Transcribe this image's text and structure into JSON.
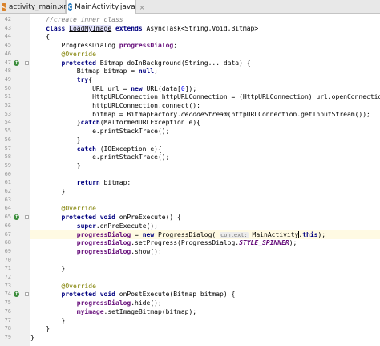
{
  "tabs": [
    {
      "label": "activity_main.xml",
      "icon": "xml-file-icon"
    },
    {
      "label": "MainActivity.java",
      "icon": "java-class-icon"
    }
  ],
  "lines": [
    {
      "n": "42",
      "t": [
        [
          "cmt",
          "    //create inner class"
        ]
      ]
    },
    {
      "n": "43",
      "t": [
        [
          "kw",
          "    class "
        ],
        [
          "cls-hl",
          "LoadMyImage"
        ],
        [
          "kw",
          " extends "
        ],
        [
          "",
          "AsyncTask<String,Void,Bitmap>"
        ]
      ]
    },
    {
      "n": "44",
      "t": [
        [
          "",
          "    {"
        ]
      ]
    },
    {
      "n": "45",
      "t": [
        [
          "",
          "        ProgressDialog "
        ],
        [
          "fld",
          "progressDialog"
        ],
        [
          "",
          ";"
        ]
      ]
    },
    {
      "n": "46",
      "t": [
        [
          "ann",
          "        @Override"
        ]
      ]
    },
    {
      "n": "47",
      "t": [
        [
          "kw",
          "        protected "
        ],
        [
          "",
          "Bitmap doInBackground(String... data) {"
        ]
      ]
    },
    {
      "n": "48",
      "t": [
        [
          "",
          "            Bitmap bitmap = "
        ],
        [
          "kw",
          "null"
        ],
        [
          "",
          ";"
        ]
      ]
    },
    {
      "n": "49",
      "t": [
        [
          "kw",
          "            try"
        ],
        [
          "",
          "{"
        ]
      ]
    },
    {
      "n": "50",
      "t": [
        [
          "",
          "                URL url = "
        ],
        [
          "kw",
          "new "
        ],
        [
          "",
          "URL(data["
        ],
        [
          "num",
          "0"
        ],
        [
          "",
          "]);"
        ]
      ]
    },
    {
      "n": "51",
      "t": [
        [
          "",
          "                HttpURLConnection httpURLConnection = (HttpURLConnection) url.openConnection();"
        ]
      ]
    },
    {
      "n": "52",
      "t": [
        [
          "",
          "                httpURLConnection.connect();"
        ]
      ]
    },
    {
      "n": "53",
      "t": [
        [
          "",
          "                bitmap = BitmapFactory."
        ],
        [
          "italic",
          "decodeStream"
        ],
        [
          "",
          "(httpURLConnection.getInputStream());"
        ]
      ]
    },
    {
      "n": "54",
      "t": [
        [
          "",
          "            }"
        ],
        [
          "kw",
          "catch"
        ],
        [
          "",
          "(MalformedURLException e){"
        ]
      ]
    },
    {
      "n": "55",
      "t": [
        [
          "",
          "                e.printStackTrace();"
        ]
      ]
    },
    {
      "n": "56",
      "t": [
        [
          "",
          "            }"
        ]
      ]
    },
    {
      "n": "57",
      "t": [
        [
          "kw",
          "            catch "
        ],
        [
          "",
          "(IOException e){"
        ]
      ]
    },
    {
      "n": "58",
      "t": [
        [
          "",
          "                e.printStackTrace();"
        ]
      ]
    },
    {
      "n": "59",
      "t": [
        [
          "",
          "            }"
        ]
      ]
    },
    {
      "n": "60",
      "t": [
        [
          "",
          ""
        ]
      ]
    },
    {
      "n": "61",
      "t": [
        [
          "kw",
          "            return "
        ],
        [
          "",
          "bitmap;"
        ]
      ]
    },
    {
      "n": "62",
      "t": [
        [
          "",
          "        }"
        ]
      ]
    },
    {
      "n": "63",
      "t": [
        [
          "",
          ""
        ]
      ]
    },
    {
      "n": "64",
      "t": [
        [
          "ann",
          "        @Override"
        ]
      ]
    },
    {
      "n": "65",
      "t": [
        [
          "kw",
          "        protected void "
        ],
        [
          "",
          "onPreExecute() {"
        ]
      ]
    },
    {
      "n": "66",
      "t": [
        [
          "kw",
          "            super"
        ],
        [
          "",
          ".onPreExecute();"
        ]
      ]
    },
    {
      "n": "67",
      "t": [
        [
          "fld",
          "            progressDialog"
        ],
        [
          "",
          " = "
        ],
        [
          "kw",
          "new "
        ],
        [
          "",
          "ProgressDialog( "
        ],
        [
          "hint",
          "context:"
        ],
        [
          "",
          " MainActivity"
        ],
        [
          "caret",
          ""
        ],
        [
          "",
          "."
        ],
        [
          "kw",
          "this"
        ],
        [
          "",
          ");"
        ]
      ]
    },
    {
      "n": "68",
      "t": [
        [
          "fld",
          "            progressDialog"
        ],
        [
          "",
          ".setProgress(ProgressDialog."
        ],
        [
          "fld italic",
          "STYLE_SPINNER"
        ],
        [
          "",
          ");"
        ]
      ]
    },
    {
      "n": "69",
      "t": [
        [
          "fld",
          "            progressDialog"
        ],
        [
          "",
          ".show();"
        ]
      ]
    },
    {
      "n": "70",
      "t": [
        [
          "",
          ""
        ]
      ]
    },
    {
      "n": "71",
      "t": [
        [
          "",
          "        }"
        ]
      ]
    },
    {
      "n": "72",
      "t": [
        [
          "",
          ""
        ]
      ]
    },
    {
      "n": "73",
      "t": [
        [
          "ann",
          "        @Override"
        ]
      ]
    },
    {
      "n": "74",
      "t": [
        [
          "kw",
          "        protected void "
        ],
        [
          "",
          "onPostExecute(Bitmap bitmap) {"
        ]
      ]
    },
    {
      "n": "75",
      "t": [
        [
          "fld",
          "            progressDialog"
        ],
        [
          "",
          ".hide();"
        ]
      ]
    },
    {
      "n": "76",
      "t": [
        [
          "fld",
          "            myimage"
        ],
        [
          "",
          ".setImageBitmap(bitmap);"
        ]
      ]
    },
    {
      "n": "77",
      "t": [
        [
          "",
          "        }"
        ]
      ]
    },
    {
      "n": "78",
      "t": [
        [
          "",
          "    }"
        ]
      ]
    },
    {
      "n": "79",
      "t": [
        [
          "",
          "}"
        ]
      ]
    }
  ],
  "gutter_markers": {
    "47": "override-marker",
    "65": "override-marker",
    "74": "override-marker"
  },
  "current_line": "67"
}
